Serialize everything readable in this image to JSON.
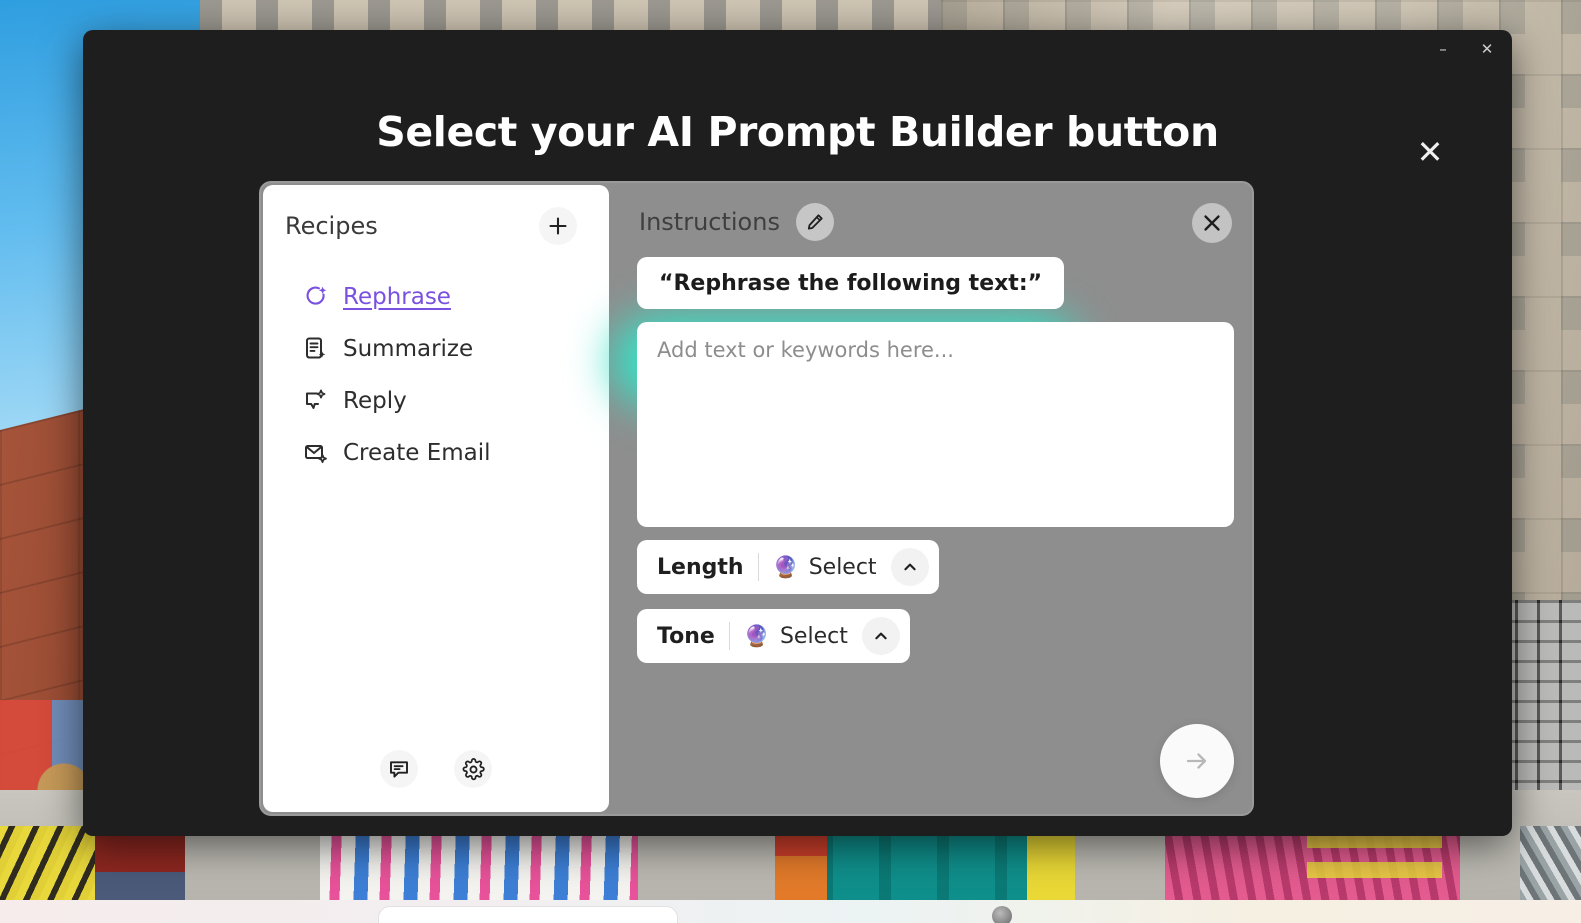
{
  "desktop": {
    "taskbar": {
      "pill_name": "taskbar-window-pill",
      "logo_name": "taskbar-app-logo"
    },
    "background_description": "city-street-photo"
  },
  "window": {
    "controls": {
      "minimize": "–",
      "close": "✕"
    }
  },
  "dialog": {
    "title": "Select your AI Prompt Builder button",
    "close_label": "✕"
  },
  "widget": {
    "recipes": {
      "title": "Recipes",
      "add_label": "+",
      "items": [
        {
          "label": "Rephrase",
          "icon": "rephrase-icon",
          "active": true
        },
        {
          "label": "Summarize",
          "icon": "summarize-icon",
          "active": false
        },
        {
          "label": "Reply",
          "icon": "reply-icon",
          "active": false
        },
        {
          "label": "Create Email",
          "icon": "create-email-icon",
          "active": false
        }
      ],
      "footer_icons": [
        {
          "name": "feedback-icon"
        },
        {
          "name": "settings-gear-icon"
        }
      ]
    },
    "instructions": {
      "title": "Instructions",
      "edit_icon": "pencil-edit-icon",
      "close_label": "✕",
      "prompt_chip": "“Rephrase the following text:”",
      "keywords_placeholder": "Add text or keywords here...",
      "controls": [
        {
          "label": "Length",
          "orb": "🔮",
          "value": "Select",
          "chevron": "chevron-up-icon"
        },
        {
          "label": "Tone",
          "orb": "🔮",
          "value": "Select",
          "chevron": "chevron-up-icon"
        }
      ],
      "submit_icon": "arrow-right-icon"
    }
  },
  "colors": {
    "accent_purple": "#7950e0",
    "highlight_teal": "#36e2c6",
    "window_background": "#1e1e1e",
    "widget_background": "#8e8e8e",
    "panel_white": "#ffffff"
  }
}
